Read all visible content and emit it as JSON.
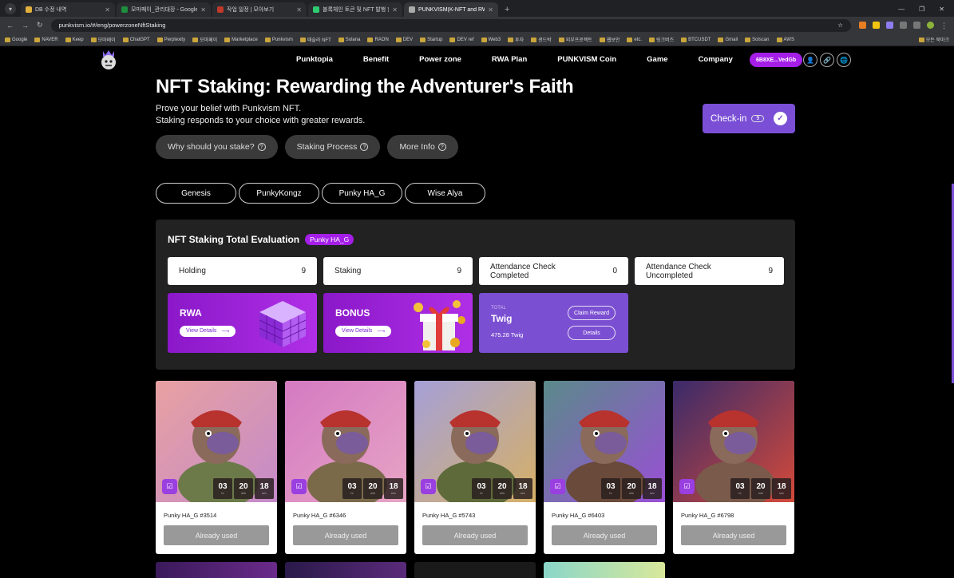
{
  "browser": {
    "tabs": [
      {
        "title": "DB 수정 내역",
        "color": "#e2b13c"
      },
      {
        "title": "모마페이_관리대장 - Google S",
        "color": "#1e8e3e"
      },
      {
        "title": "작업 일정 | 모아보기",
        "color": "#c0392b"
      },
      {
        "title": "블록체인 토큰 및 NFT 발행 한",
        "color": "#2ecc71"
      },
      {
        "title": "PUNKVISM(K-NFT and RWA)",
        "color": "#aaaaaa",
        "active": true
      }
    ],
    "url": "punkvism.io/#/eng/powerzoneNftStaking",
    "bookmarks": [
      "Google",
      "NAVER",
      "Keep",
      "모마페이",
      "ChatGPT",
      "Perplexity",
      "모마페이",
      "Marketplace",
      "Punkvism",
      "때슬라 NFT",
      "Solana",
      "RAON",
      "DEV",
      "Startup",
      "DEV ref",
      "Web3",
      "투자",
      "샌드박",
      "외부프로젝트",
      "웹보안",
      "etc.",
      "링크버즈",
      "BTCUSDT",
      "Gmail",
      "Solscan",
      "AWS"
    ],
    "bookmarks_other": "모든 북마크"
  },
  "nav": {
    "menu": [
      "Punktopia",
      "Benefit",
      "Power zone",
      "RWA Plan",
      "PUNKVISM Coin",
      "Game",
      "Company"
    ],
    "wallet": "6B8XE...VedGb"
  },
  "hero": {
    "title": "NFT Staking: Rewarding the Adventurer's Faith",
    "line1": "Prove your belief with Punkvism NFT.",
    "line2": "Staking responds to your choice with greater rewards.",
    "buttons": [
      "Why should you stake?",
      "Staking Process",
      "More Info"
    ],
    "checkin_label": "Check-in",
    "checkin_count": "9"
  },
  "collections": [
    "Genesis",
    "PunkyKongz",
    "Punky HA_G",
    "Wise Alya"
  ],
  "panel": {
    "title": "NFT Staking Total Evaluation",
    "tag": "Punky HA_G",
    "stats": [
      {
        "label": "Holding",
        "value": "9"
      },
      {
        "label": "Staking",
        "value": "9"
      },
      {
        "label": "Attendance Check Completed",
        "value": "0"
      },
      {
        "label": "Attendance Check Uncompleted",
        "value": "9"
      }
    ],
    "rwa": {
      "label": "RWA",
      "details": "View Details"
    },
    "bonus": {
      "label": "BONUS",
      "details": "View Details"
    },
    "twig": {
      "total": "TOTAL",
      "name": "Twig",
      "value": "475.28 Twig",
      "claim": "Claim Reward",
      "details": "Details"
    }
  },
  "nfts": [
    {
      "name": "Punky HA_G #3514",
      "h": "03",
      "m": "20",
      "s": "18",
      "button": "Already used"
    },
    {
      "name": "Punky HA_G #6346",
      "h": "03",
      "m": "20",
      "s": "18",
      "button": "Already used"
    },
    {
      "name": "Punky HA_G #5743",
      "h": "03",
      "m": "20",
      "s": "18",
      "button": "Already used"
    },
    {
      "name": "Punky HA_G #6403",
      "h": "03",
      "m": "20",
      "s": "18",
      "button": "Already used"
    },
    {
      "name": "Punky HA_G #6798",
      "h": "03",
      "m": "20",
      "s": "18",
      "button": "Already used"
    }
  ],
  "timer_units": {
    "h": "hr",
    "m": "min",
    "s": "sec"
  }
}
